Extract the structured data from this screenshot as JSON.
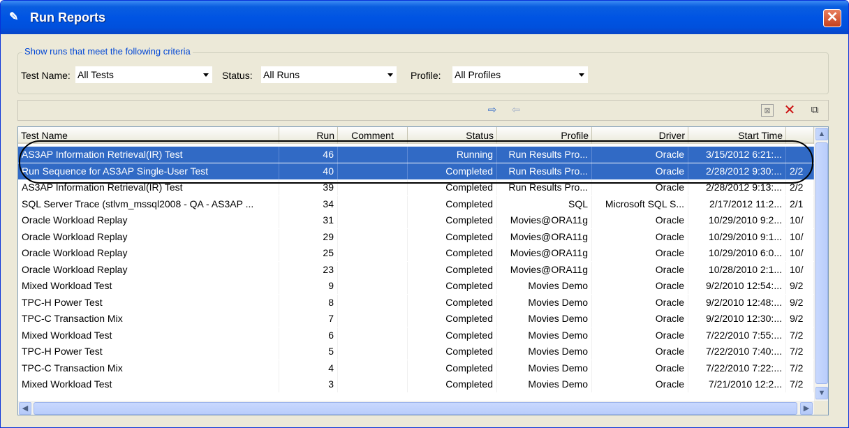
{
  "window": {
    "title": "Run Reports",
    "close_glyph": "✕"
  },
  "criteria": {
    "legend": "Show runs that meet the following criteria",
    "test_name_label": "Test Name:",
    "test_name_value": "All Tests",
    "status_label": "Status:",
    "status_value": "All Runs",
    "profile_label": "Profile:",
    "profile_value": "All Profiles"
  },
  "toolbar": {
    "icons": [
      "export-icon",
      "import-icon",
      "clear-filter-icon",
      "delete-icon",
      "open-report-icon"
    ],
    "delete_color": "#cc1010"
  },
  "grid": {
    "columns": [
      "Test Name",
      "Run",
      "Comment",
      "Status",
      "Profile",
      "Driver",
      "Start Time"
    ],
    "rows": [
      {
        "name": "AS3AP Information Retrieval(IR) Test",
        "run": "46",
        "comment": "",
        "status": "Running",
        "profile": "Run Results Pro...",
        "driver": "Oracle",
        "start": "3/15/2012 6:21:...",
        "extra": "",
        "selected": true
      },
      {
        "name": "Run Sequence for AS3AP Single-User Test",
        "run": "40",
        "comment": "",
        "status": "Completed",
        "profile": "Run Results Pro...",
        "driver": "Oracle",
        "start": "2/28/2012 9:30:...",
        "extra": "2/2",
        "selected": true
      },
      {
        "name": "AS3AP Information Retrieval(IR) Test",
        "run": "39",
        "comment": "",
        "status": "Completed",
        "profile": "Run Results Pro...",
        "driver": "Oracle",
        "start": "2/28/2012 9:13:...",
        "extra": "2/2",
        "selected": false
      },
      {
        "name": "SQL Server Trace (stlvm_mssql2008 - QA - AS3AP ...",
        "run": "34",
        "comment": "",
        "status": "Completed",
        "profile": "SQL",
        "driver": "Microsoft SQL S...",
        "start": "2/17/2012 11:2...",
        "extra": "2/1",
        "selected": false
      },
      {
        "name": "Oracle Workload Replay",
        "run": "31",
        "comment": "",
        "status": "Completed",
        "profile": "Movies@ORA11g",
        "driver": "Oracle",
        "start": "10/29/2010 9:2...",
        "extra": "10/",
        "selected": false
      },
      {
        "name": "Oracle Workload Replay",
        "run": "29",
        "comment": "",
        "status": "Completed",
        "profile": "Movies@ORA11g",
        "driver": "Oracle",
        "start": "10/29/2010 9:1...",
        "extra": "10/",
        "selected": false
      },
      {
        "name": "Oracle Workload Replay",
        "run": "25",
        "comment": "",
        "status": "Completed",
        "profile": "Movies@ORA11g",
        "driver": "Oracle",
        "start": "10/29/2010 6:0...",
        "extra": "10/",
        "selected": false
      },
      {
        "name": "Oracle Workload Replay",
        "run": "23",
        "comment": "",
        "status": "Completed",
        "profile": "Movies@ORA11g",
        "driver": "Oracle",
        "start": "10/28/2010 2:1...",
        "extra": "10/",
        "selected": false
      },
      {
        "name": "Mixed Workload Test",
        "run": "9",
        "comment": "",
        "status": "Completed",
        "profile": "Movies Demo",
        "driver": "Oracle",
        "start": "9/2/2010 12:54:...",
        "extra": "9/2",
        "selected": false
      },
      {
        "name": "TPC-H Power Test",
        "run": "8",
        "comment": "",
        "status": "Completed",
        "profile": "Movies Demo",
        "driver": "Oracle",
        "start": "9/2/2010 12:48:...",
        "extra": "9/2",
        "selected": false
      },
      {
        "name": "TPC-C Transaction Mix",
        "run": "7",
        "comment": "",
        "status": "Completed",
        "profile": "Movies Demo",
        "driver": "Oracle",
        "start": "9/2/2010 12:30:...",
        "extra": "9/2",
        "selected": false
      },
      {
        "name": "Mixed Workload Test",
        "run": "6",
        "comment": "",
        "status": "Completed",
        "profile": "Movies Demo",
        "driver": "Oracle",
        "start": "7/22/2010 7:55:...",
        "extra": "7/2",
        "selected": false
      },
      {
        "name": "TPC-H Power Test",
        "run": "5",
        "comment": "",
        "status": "Completed",
        "profile": "Movies Demo",
        "driver": "Oracle",
        "start": "7/22/2010 7:40:...",
        "extra": "7/2",
        "selected": false
      },
      {
        "name": "TPC-C Transaction Mix",
        "run": "4",
        "comment": "",
        "status": "Completed",
        "profile": "Movies Demo",
        "driver": "Oracle",
        "start": "7/22/2010 7:22:...",
        "extra": "7/2",
        "selected": false
      },
      {
        "name": "Mixed Workload Test",
        "run": "3",
        "comment": "",
        "status": "Completed",
        "profile": "Movies Demo",
        "driver": "Oracle",
        "start": "7/21/2010 12:2...",
        "extra": "7/2",
        "selected": false
      }
    ]
  },
  "colors": {
    "selection": "#316ac5",
    "title_bar": "#0054e3",
    "legend_text": "#0046d5"
  }
}
